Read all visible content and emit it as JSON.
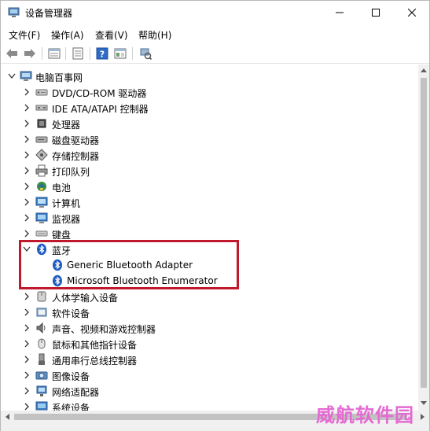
{
  "window": {
    "title": "设备管理器",
    "controls": {
      "minimize": "minimize",
      "maximize": "maximize",
      "close": "close"
    }
  },
  "menu": [
    {
      "label": "文件(F)"
    },
    {
      "label": "操作(A)"
    },
    {
      "label": "查看(V)"
    },
    {
      "label": "帮助(H)"
    }
  ],
  "toolbar": [
    {
      "icon": "back-arrow-icon"
    },
    {
      "icon": "forward-arrow-icon"
    },
    {
      "icon": "properties-icon"
    },
    {
      "icon": "list-view-icon"
    },
    {
      "icon": "help-icon"
    },
    {
      "icon": "show-hidden-icon"
    },
    {
      "icon": "scan-hardware-icon"
    }
  ],
  "tree": {
    "root": {
      "label": "电脑百事网",
      "expanded": true,
      "icon": "computer-icon"
    },
    "items": [
      {
        "label": "DVD/CD-ROM 驱动器",
        "icon": "dvd-drive-icon",
        "expanded": false
      },
      {
        "label": "IDE ATA/ATAPI 控制器",
        "icon": "ide-controller-icon",
        "expanded": false
      },
      {
        "label": "处理器",
        "icon": "processor-icon",
        "expanded": false
      },
      {
        "label": "磁盘驱动器",
        "icon": "disk-drive-icon",
        "expanded": false
      },
      {
        "label": "存储控制器",
        "icon": "storage-controller-icon",
        "expanded": false
      },
      {
        "label": "打印队列",
        "icon": "printer-icon",
        "expanded": false
      },
      {
        "label": "电池",
        "icon": "battery-icon",
        "expanded": false
      },
      {
        "label": "计算机",
        "icon": "computer-monitor-icon",
        "expanded": false
      },
      {
        "label": "监视器",
        "icon": "monitor-icon",
        "expanded": false
      },
      {
        "label": "键盘",
        "icon": "keyboard-icon",
        "expanded": false
      },
      {
        "label": "蓝牙",
        "icon": "bluetooth-icon",
        "expanded": true,
        "children": [
          {
            "label": "Generic Bluetooth Adapter",
            "icon": "bluetooth-icon"
          },
          {
            "label": "Microsoft Bluetooth Enumerator",
            "icon": "bluetooth-icon"
          }
        ]
      },
      {
        "label": "人体学输入设备",
        "icon": "hid-icon",
        "expanded": false
      },
      {
        "label": "软件设备",
        "icon": "software-device-icon",
        "expanded": false
      },
      {
        "label": "声音、视频和游戏控制器",
        "icon": "speaker-icon",
        "expanded": false
      },
      {
        "label": "鼠标和其他指针设备",
        "icon": "mouse-icon",
        "expanded": false
      },
      {
        "label": "通用串行总线控制器",
        "icon": "usb-icon",
        "expanded": false
      },
      {
        "label": "图像设备",
        "icon": "camera-icon",
        "expanded": false
      },
      {
        "label": "网络适配器",
        "icon": "network-adapter-icon",
        "expanded": false
      },
      {
        "label": "系统设备",
        "icon": "system-device-icon",
        "expanded": false
      }
    ]
  },
  "watermark": "威航软件园",
  "colors": {
    "highlight_box": "#c0192b",
    "bluetooth": "#1e5bbf",
    "watermark": "#e46ad2"
  }
}
